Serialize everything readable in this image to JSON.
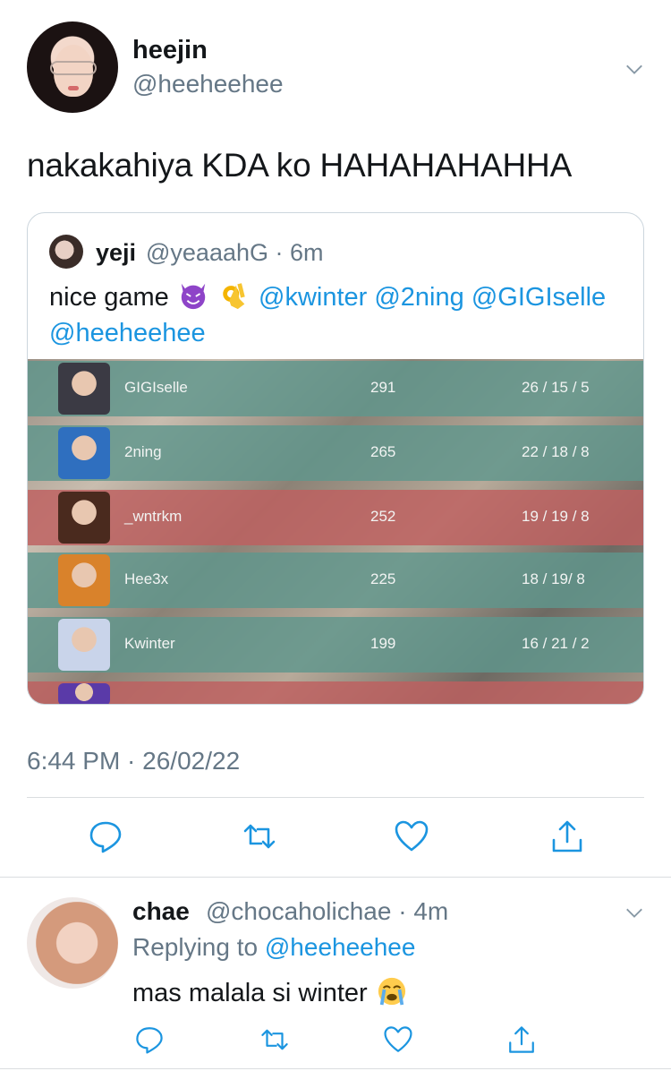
{
  "tweet": {
    "author_name": "heejin",
    "author_handle": "@heeheehee",
    "text": "nakakahiya KDA ko HAHAHAHAHHA",
    "timestamp": "6:44 PM · 26/02/22"
  },
  "quote": {
    "author_name": "yeji",
    "author_meta": "@yeaaahG · 6m",
    "text_prefix": "nice game",
    "mentions": [
      "@kwinter",
      "@2ning",
      "@GIGIselle",
      "@heeheehee"
    ],
    "scoreboard": [
      {
        "name": "GIGIselle",
        "score": "291",
        "kda": "26 / 15 / 5",
        "team": "teal",
        "agent_color": "#3b3a44"
      },
      {
        "name": "2ning",
        "score": "265",
        "kda": "22 / 18 / 8",
        "team": "teal",
        "agent_color": "#2f6fbf"
      },
      {
        "name": "_wntrkm",
        "score": "252",
        "kda": "19 / 19 / 8",
        "team": "red",
        "agent_color": "#4a2a1e"
      },
      {
        "name": "Hee3x",
        "score": "225",
        "kda": "18 / 19/ 8",
        "team": "teal",
        "agent_color": "#d9822b"
      },
      {
        "name": "Kwinter",
        "score": "199",
        "kda": "16 / 21 / 2",
        "team": "teal",
        "agent_color": "#c9d4ea"
      },
      {
        "name": "",
        "score": "",
        "kda": "",
        "team": "red",
        "agent_color": "#5a3aa8"
      }
    ]
  },
  "reply": {
    "author_name": "chae",
    "author_meta": "@chocaholichae · 4m",
    "replying_label": "Replying to",
    "replying_handle": "@heeheehee",
    "text": "mas malala si winter"
  },
  "colors": {
    "accent": "#1b95e0",
    "secondary_text": "#657786",
    "icon_gray": "#1b95e0"
  },
  "icons": {
    "reply": "reply-icon",
    "retweet": "retweet-icon",
    "like": "heart-icon",
    "share": "share-icon",
    "more": "chevron-down-icon"
  }
}
